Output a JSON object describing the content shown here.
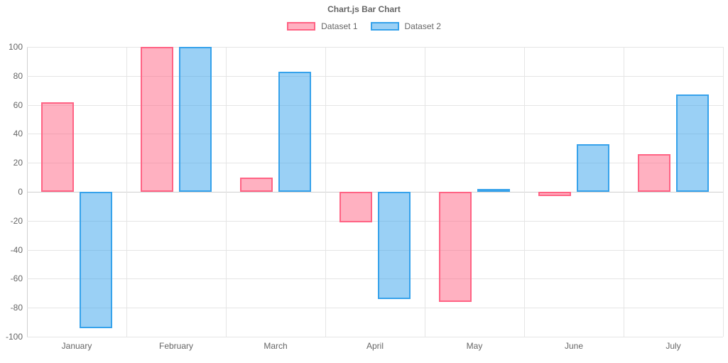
{
  "title": "Chart.js Bar Chart",
  "legend": [
    {
      "label": "Dataset 1",
      "fill": "rgba(255,99,132,0.5)",
      "border": "#ff6384"
    },
    {
      "label": "Dataset 2",
      "fill": "rgba(54,162,235,0.5)",
      "border": "#36a2eb"
    }
  ],
  "chart_data": {
    "type": "bar",
    "title": "Chart.js Bar Chart",
    "xlabel": "",
    "ylabel": "",
    "categories": [
      "January",
      "February",
      "March",
      "April",
      "May",
      "June",
      "July"
    ],
    "series": [
      {
        "name": "Dataset 1",
        "values": [
          62,
          100,
          10,
          -21,
          -76,
          -3,
          26
        ],
        "fill": "rgba(255,99,132,0.5)",
        "border": "#ff6384"
      },
      {
        "name": "Dataset 2",
        "values": [
          -94,
          100,
          83,
          -74,
          2,
          33,
          67
        ],
        "fill": "rgba(54,162,235,0.5)",
        "border": "#36a2eb"
      }
    ],
    "ylim": [
      -100,
      100
    ],
    "yticks": [
      -100,
      -80,
      -60,
      -40,
      -20,
      0,
      20,
      40,
      60,
      80,
      100
    ],
    "grid": true,
    "legend_position": "top"
  }
}
